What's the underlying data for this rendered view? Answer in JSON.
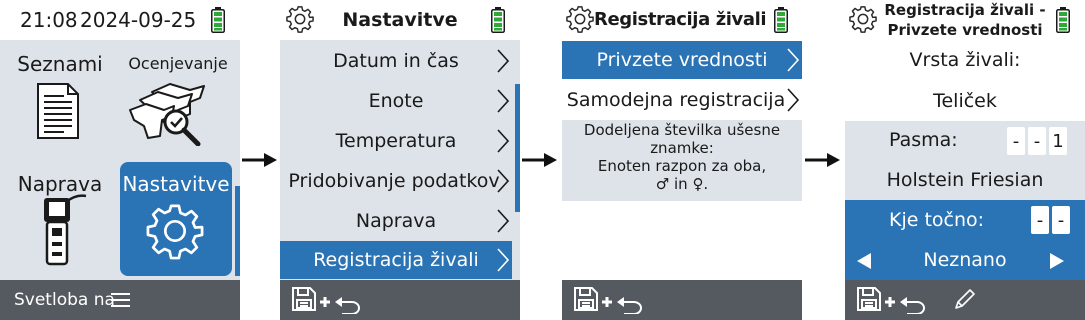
{
  "screen1": {
    "time": "21:08",
    "date": "2024-09-25",
    "tiles": [
      "Seznami",
      "Ocenjevanje",
      "Naprava",
      "Nastavitve"
    ],
    "footer_label": "Svetloba na"
  },
  "screen2": {
    "title": "Nastavitve",
    "items": [
      "Datum in čas",
      "Enote",
      "Temperatura",
      "Pridobivanje podatkov",
      "Naprava",
      "Registracija živali"
    ],
    "selected_index": 5
  },
  "screen3": {
    "title": "Registracija živali",
    "items": [
      "Privzete vrednosti",
      "Samodejna registracija"
    ],
    "selected_index": 0,
    "info": [
      "Dodeljena številka ušesne",
      "znamke:",
      "Enoten razpon za oba,",
      "♂ in ♀."
    ]
  },
  "screen4": {
    "title_line1": "Registracija živali -",
    "title_line2": "Privzete vrednosti",
    "animal_type_label": "Vrsta živali:",
    "animal_type_value": "Teliček",
    "breed_label": "Pasma:",
    "breed_digits": [
      "-",
      "-",
      "1"
    ],
    "breed_value": "Holstein Friesian",
    "exact_label": "Kje točno:",
    "exact_digits": [
      "-",
      "-"
    ],
    "exact_value": "Neznano"
  },
  "icons": {
    "battery": "battery-full-icon",
    "settings": "gear-icon",
    "save_back": "save-and-back-icon",
    "edit": "pencil-icon",
    "menu": "hamburger-menu-icon"
  },
  "colors": {
    "accent": "#2a73b5",
    "panel_gray": "#dde3e9",
    "footer": "#555a60",
    "battery": "#2fa83a"
  }
}
